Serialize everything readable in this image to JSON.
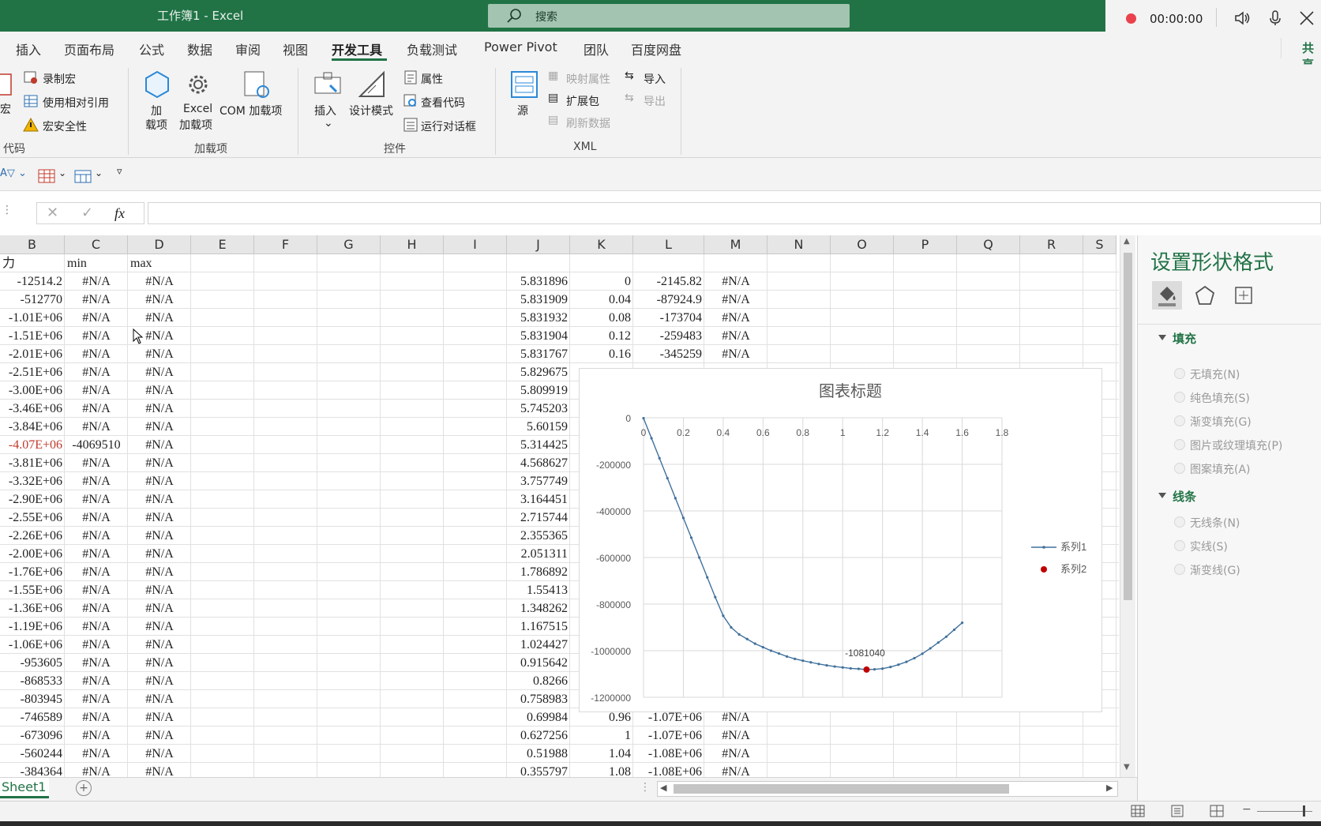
{
  "window": {
    "title": "工作簿1  -  Excel",
    "search_placeholder": "搜索"
  },
  "recorder": {
    "time": "00:00:00"
  },
  "tabs": [
    "插入",
    "页面布局",
    "公式",
    "数据",
    "审阅",
    "视图",
    "开发工具",
    "负载测试",
    "Power Pivot",
    "团队",
    "百度网盘"
  ],
  "active_tab": "开发工具",
  "share_label": "共享",
  "ribbon": {
    "code": {
      "record_macro": "录制宏",
      "relative_ref": "使用相对引用",
      "macro_security": "宏安全性",
      "macro_cut": "宏",
      "group": "代码"
    },
    "addins": {
      "addin_1": "加",
      "addin_2": "载项",
      "excel_1": "Excel",
      "excel_2": "加载项",
      "com": "COM 加载项",
      "group": "加载项"
    },
    "controls": {
      "insert": "插入",
      "design_mode": "设计模式",
      "properties": "属性",
      "view_code": "查看代码",
      "run_dialog": "运行对话框",
      "group": "控件"
    },
    "xml": {
      "source": "源",
      "map_props": "映射属性",
      "expansion": "扩展包",
      "refresh": "刷新数据",
      "import": "导入",
      "export": "导出",
      "group": "XML"
    }
  },
  "formula_bar": {
    "fx": "fx",
    "value": ""
  },
  "columns": [
    "B",
    "C",
    "D",
    "E",
    "F",
    "G",
    "H",
    "I",
    "J",
    "K",
    "L",
    "M",
    "N",
    "O",
    "P",
    "Q",
    "R",
    "S"
  ],
  "header_row": {
    "B": "力",
    "C": "min",
    "D": "max"
  },
  "rows": [
    {
      "B": "-12514.2",
      "C": "#N/A",
      "D": "#N/A",
      "J": "5.831896",
      "K": "0",
      "L": "-2145.82",
      "M": "#N/A"
    },
    {
      "B": "-512770",
      "C": "#N/A",
      "D": "#N/A",
      "J": "5.831909",
      "K": "0.04",
      "L": "-87924.9",
      "M": "#N/A"
    },
    {
      "B": "-1.01E+06",
      "C": "#N/A",
      "D": "#N/A",
      "J": "5.831932",
      "K": "0.08",
      "L": "-173704",
      "M": "#N/A"
    },
    {
      "B": "-1.51E+06",
      "C": "#N/A",
      "D": "#N/A",
      "J": "5.831904",
      "K": "0.12",
      "L": "-259483",
      "M": "#N/A"
    },
    {
      "B": "-2.01E+06",
      "C": "#N/A",
      "D": "#N/A",
      "J": "5.831767",
      "K": "0.16",
      "L": "-345259",
      "M": "#N/A"
    },
    {
      "B": "-2.51E+06",
      "C": "#N/A",
      "D": "#N/A",
      "J": "5.829675"
    },
    {
      "B": "-3.00E+06",
      "C": "#N/A",
      "D": "#N/A",
      "J": "5.809919"
    },
    {
      "B": "-3.46E+06",
      "C": "#N/A",
      "D": "#N/A",
      "J": "5.745203"
    },
    {
      "B": "-3.84E+06",
      "C": "#N/A",
      "D": "#N/A",
      "J": "5.60159"
    },
    {
      "B": "-4.07E+06",
      "C": "-4069510",
      "D": "#N/A",
      "J": "5.314425",
      "red": true
    },
    {
      "B": "-3.81E+06",
      "C": "#N/A",
      "D": "#N/A",
      "J": "4.568627"
    },
    {
      "B": "-3.32E+06",
      "C": "#N/A",
      "D": "#N/A",
      "J": "3.757749"
    },
    {
      "B": "-2.90E+06",
      "C": "#N/A",
      "D": "#N/A",
      "J": "3.164451"
    },
    {
      "B": "-2.55E+06",
      "C": "#N/A",
      "D": "#N/A",
      "J": "2.715744"
    },
    {
      "B": "-2.26E+06",
      "C": "#N/A",
      "D": "#N/A",
      "J": "2.355365"
    },
    {
      "B": "-2.00E+06",
      "C": "#N/A",
      "D": "#N/A",
      "J": "2.051311"
    },
    {
      "B": "-1.76E+06",
      "C": "#N/A",
      "D": "#N/A",
      "J": "1.786892"
    },
    {
      "B": "-1.55E+06",
      "C": "#N/A",
      "D": "#N/A",
      "J": "1.55413"
    },
    {
      "B": "-1.36E+06",
      "C": "#N/A",
      "D": "#N/A",
      "J": "1.348262"
    },
    {
      "B": "-1.19E+06",
      "C": "#N/A",
      "D": "#N/A",
      "J": "1.167515"
    },
    {
      "B": "-1.06E+06",
      "C": "#N/A",
      "D": "#N/A",
      "J": "1.024427"
    },
    {
      "B": "-953605",
      "C": "#N/A",
      "D": "#N/A",
      "J": "0.915642"
    },
    {
      "B": "-868533",
      "C": "#N/A",
      "D": "#N/A",
      "J": "0.8266"
    },
    {
      "B": "-803945",
      "C": "#N/A",
      "D": "#N/A",
      "J": "0.758983"
    },
    {
      "B": "-746589",
      "C": "#N/A",
      "D": "#N/A",
      "J": "0.69984",
      "K": "0.96",
      "L": "-1.07E+06",
      "M": "#N/A"
    },
    {
      "B": "-673096",
      "C": "#N/A",
      "D": "#N/A",
      "J": "0.627256",
      "K": "1",
      "L": "-1.07E+06",
      "M": "#N/A"
    },
    {
      "B": "-560244",
      "C": "#N/A",
      "D": "#N/A",
      "J": "0.51988",
      "K": "1.04",
      "L": "-1.08E+06",
      "M": "#N/A"
    },
    {
      "B": "-384364",
      "C": "#N/A",
      "D": "#N/A",
      "J": "0.355797",
      "K": "1.08",
      "L": "-1.08E+06",
      "M": "#N/A"
    }
  ],
  "sheet_tab": "Sheet1",
  "format_pane": {
    "title": "设置形状格式",
    "fill": {
      "heading": "填充",
      "options": [
        "无填充(N)",
        "纯色填充(S)",
        "渐变填充(G)",
        "图片或纹理填充(P)",
        "图案填充(A)"
      ]
    },
    "line": {
      "heading": "线条",
      "options": [
        "无线条(N)",
        "实线(S)",
        "渐变线(G)"
      ]
    }
  },
  "chart_data": {
    "type": "scatter",
    "title": "图表标题",
    "xlim": [
      0,
      1.8
    ],
    "ylim": [
      -1200000,
      0
    ],
    "x_ticks": [
      "0",
      "0.2",
      "0.4",
      "0.6",
      "0.8",
      "1",
      "1.2",
      "1.4",
      "1.6",
      "1.8"
    ],
    "y_ticks": [
      "0",
      "-200000",
      "-400000",
      "-600000",
      "-800000",
      "-1000000",
      "-1200000"
    ],
    "grid": true,
    "legend_position": "right",
    "series": [
      {
        "name": "系列1",
        "style": "line-markers",
        "color": "#41719c",
        "x": [
          0,
          0.04,
          0.08,
          0.12,
          0.16,
          0.2,
          0.24,
          0.28,
          0.32,
          0.36,
          0.4,
          0.44,
          0.48,
          0.52,
          0.56,
          0.6,
          0.64,
          0.68,
          0.72,
          0.76,
          0.8,
          0.84,
          0.88,
          0.92,
          0.96,
          1.0,
          1.04,
          1.08,
          1.12,
          1.16,
          1.2,
          1.24,
          1.28,
          1.32,
          1.36,
          1.4,
          1.44,
          1.48,
          1.52,
          1.56,
          1.6
        ],
        "y": [
          -2146,
          -87925,
          -173704,
          -259483,
          -345259,
          -430000,
          -515000,
          -600000,
          -685000,
          -770000,
          -850000,
          -900000,
          -930000,
          -950000,
          -970000,
          -985000,
          -1000000,
          -1012000,
          -1025000,
          -1035000,
          -1043000,
          -1050000,
          -1057000,
          -1063000,
          -1068000,
          -1072000,
          -1076000,
          -1078000,
          -1081040,
          -1080000,
          -1077000,
          -1070000,
          -1060000,
          -1048000,
          -1032000,
          -1013000,
          -990000,
          -965000,
          -940000,
          -910000,
          -880000
        ]
      },
      {
        "name": "系列2",
        "style": "marker",
        "color": "#c00000",
        "x": [
          1.12
        ],
        "y": [
          -1081040
        ]
      }
    ],
    "annotations": [
      {
        "text": "-1081040",
        "x": 1.12,
        "y": -1081040
      }
    ]
  }
}
